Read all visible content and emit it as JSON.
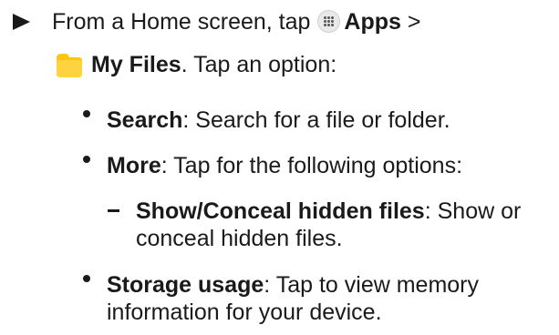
{
  "colors": {
    "text": "#1a1a1a",
    "folder_yellow": "#ffc413",
    "apps_icon_bg": "#e9e9e9"
  },
  "icons": [
    "arrow-icon",
    "apps-icon",
    "my-files-folder-icon",
    "bullet-icon",
    "dash-icon"
  ],
  "step": {
    "prefix": "From a Home screen, tap",
    "apps_label": "Apps",
    "separator": ">",
    "my_files_label": "My Files",
    "suffix": ". Tap an option:"
  },
  "options": [
    {
      "label": "Search",
      "description": ": Search for a file or folder."
    },
    {
      "label": "More",
      "description": ": Tap for the following options:"
    },
    {
      "label": "Storage usage",
      "description_line1": ": Tap to view memory",
      "description_line2": "information for your device."
    }
  ],
  "sub_option": {
    "label": "Show/Conceal hidden files",
    "description_line1": ": Show or",
    "description_line2": "conceal hidden files."
  }
}
